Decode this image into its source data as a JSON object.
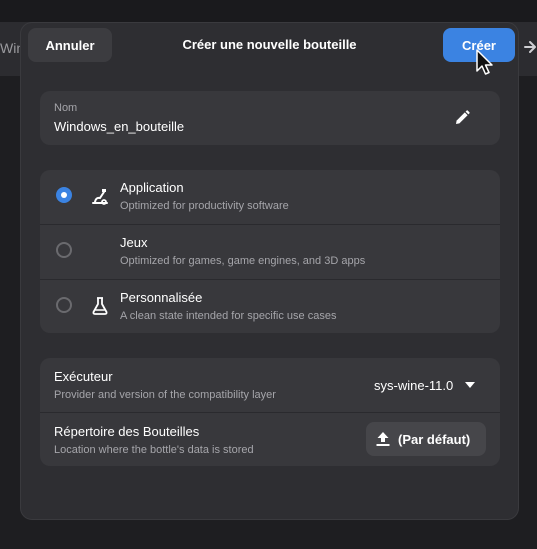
{
  "background": {
    "left_text": "Win"
  },
  "dialog": {
    "cancel_label": "Annuler",
    "title": "Créer une nouvelle bouteille",
    "create_label": "Créer"
  },
  "name_field": {
    "label": "Nom",
    "value": "Windows_en_bouteille"
  },
  "bottle_types": [
    {
      "title": "Application",
      "subtitle": "Optimized for productivity software",
      "selected": true,
      "icon": "tools-icon"
    },
    {
      "title": "Jeux",
      "subtitle": "Optimized for games, game engines, and 3D apps",
      "selected": false,
      "icon": ""
    },
    {
      "title": "Personnalisée",
      "subtitle": "A clean state intended for specific use cases",
      "selected": false,
      "icon": "flask-icon"
    }
  ],
  "runner": {
    "title": "Exécuteur",
    "subtitle": "Provider and version of the compatibility layer",
    "value": "sys-wine-11.0"
  },
  "directory": {
    "title": "Répertoire des Bouteilles",
    "subtitle": "Location where the bottle's data is stored",
    "button_label": "(Par défaut)"
  },
  "colors": {
    "accent": "#3b83e2",
    "dialog_bg": "#2e2e32",
    "card_bg": "#38383c"
  }
}
